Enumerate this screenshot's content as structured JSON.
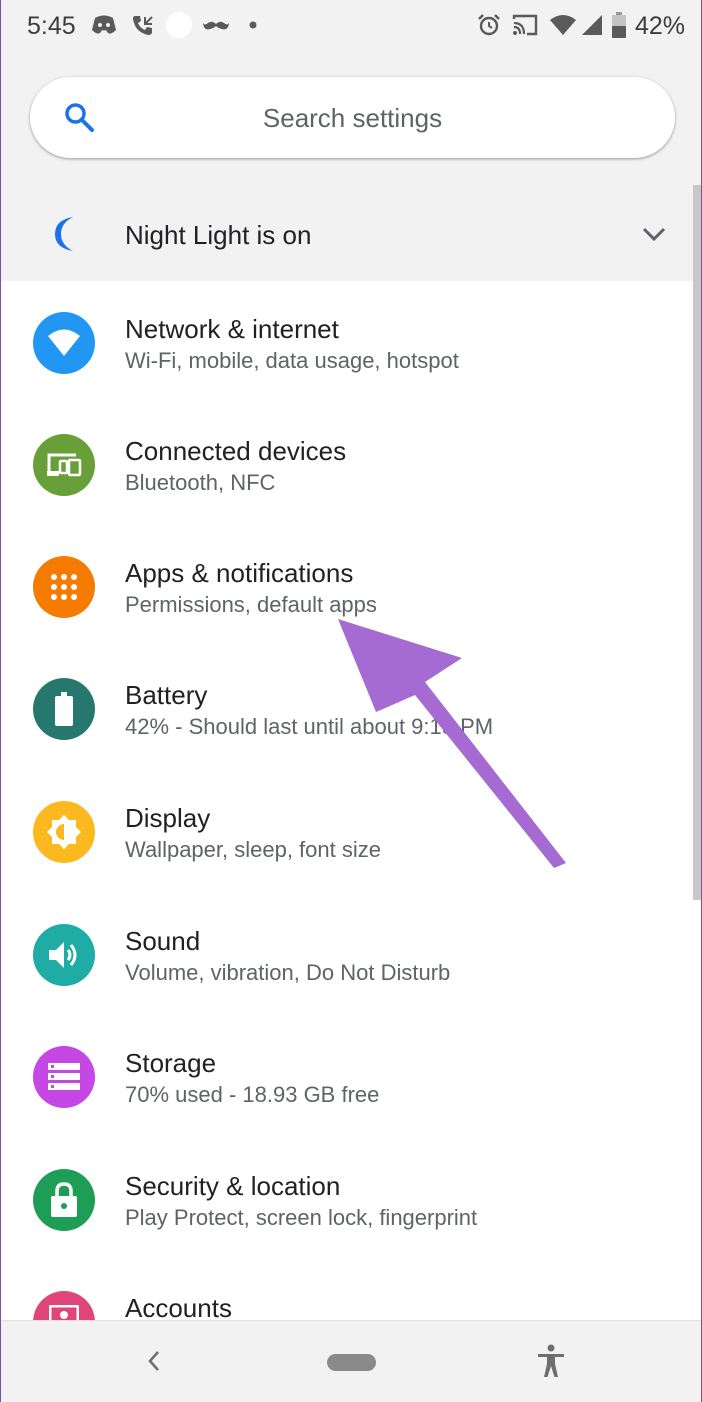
{
  "status_bar": {
    "time": "5:45",
    "battery": "42%",
    "icons_left": [
      "discord-icon",
      "missed-call-icon",
      "circle-icon",
      "mustache-icon",
      "dot-icon"
    ],
    "icons_right": [
      "alarm-icon",
      "cast-icon",
      "wifi-icon",
      "signal-icon",
      "battery-icon"
    ]
  },
  "search": {
    "placeholder": "Search settings"
  },
  "suggestion": {
    "label": "Night Light is on",
    "icon": "moon-icon"
  },
  "settings": [
    {
      "title": "Network & internet",
      "subtitle": "Wi-Fi, mobile, data usage, hotspot",
      "icon": "wifi-icon",
      "color": "#2196F3"
    },
    {
      "title": "Connected devices",
      "subtitle": "Bluetooth, NFC",
      "icon": "devices-icon",
      "color": "#689F38"
    },
    {
      "title": "Apps & notifications",
      "subtitle": "Permissions, default apps",
      "icon": "apps-grid-icon",
      "color": "#F57C00"
    },
    {
      "title": "Battery",
      "subtitle": "42% - Should last until about 9:15 PM",
      "icon": "battery-icon",
      "color": "#26786E"
    },
    {
      "title": "Display",
      "subtitle": "Wallpaper, sleep, font size",
      "icon": "brightness-icon",
      "color": "#FBB91F"
    },
    {
      "title": "Sound",
      "subtitle": "Volume, vibration, Do Not Disturb",
      "icon": "volume-icon",
      "color": "#1EACA5"
    },
    {
      "title": "Storage",
      "subtitle": "70% used - 18.93 GB free",
      "icon": "storage-icon",
      "color": "#C548E5"
    },
    {
      "title": "Security & location",
      "subtitle": "Play Protect, screen lock, fingerprint",
      "icon": "lock-icon",
      "color": "#1E9E55"
    },
    {
      "title": "Accounts",
      "subtitle": "",
      "icon": "account-icon",
      "color": "#E0457A"
    }
  ],
  "annotation": {
    "type": "arrow",
    "color": "#A56BD2",
    "points_to": "Apps & notifications"
  },
  "nav_bar": {
    "buttons": [
      "back-icon",
      "home-pill",
      "accessibility-icon"
    ]
  }
}
